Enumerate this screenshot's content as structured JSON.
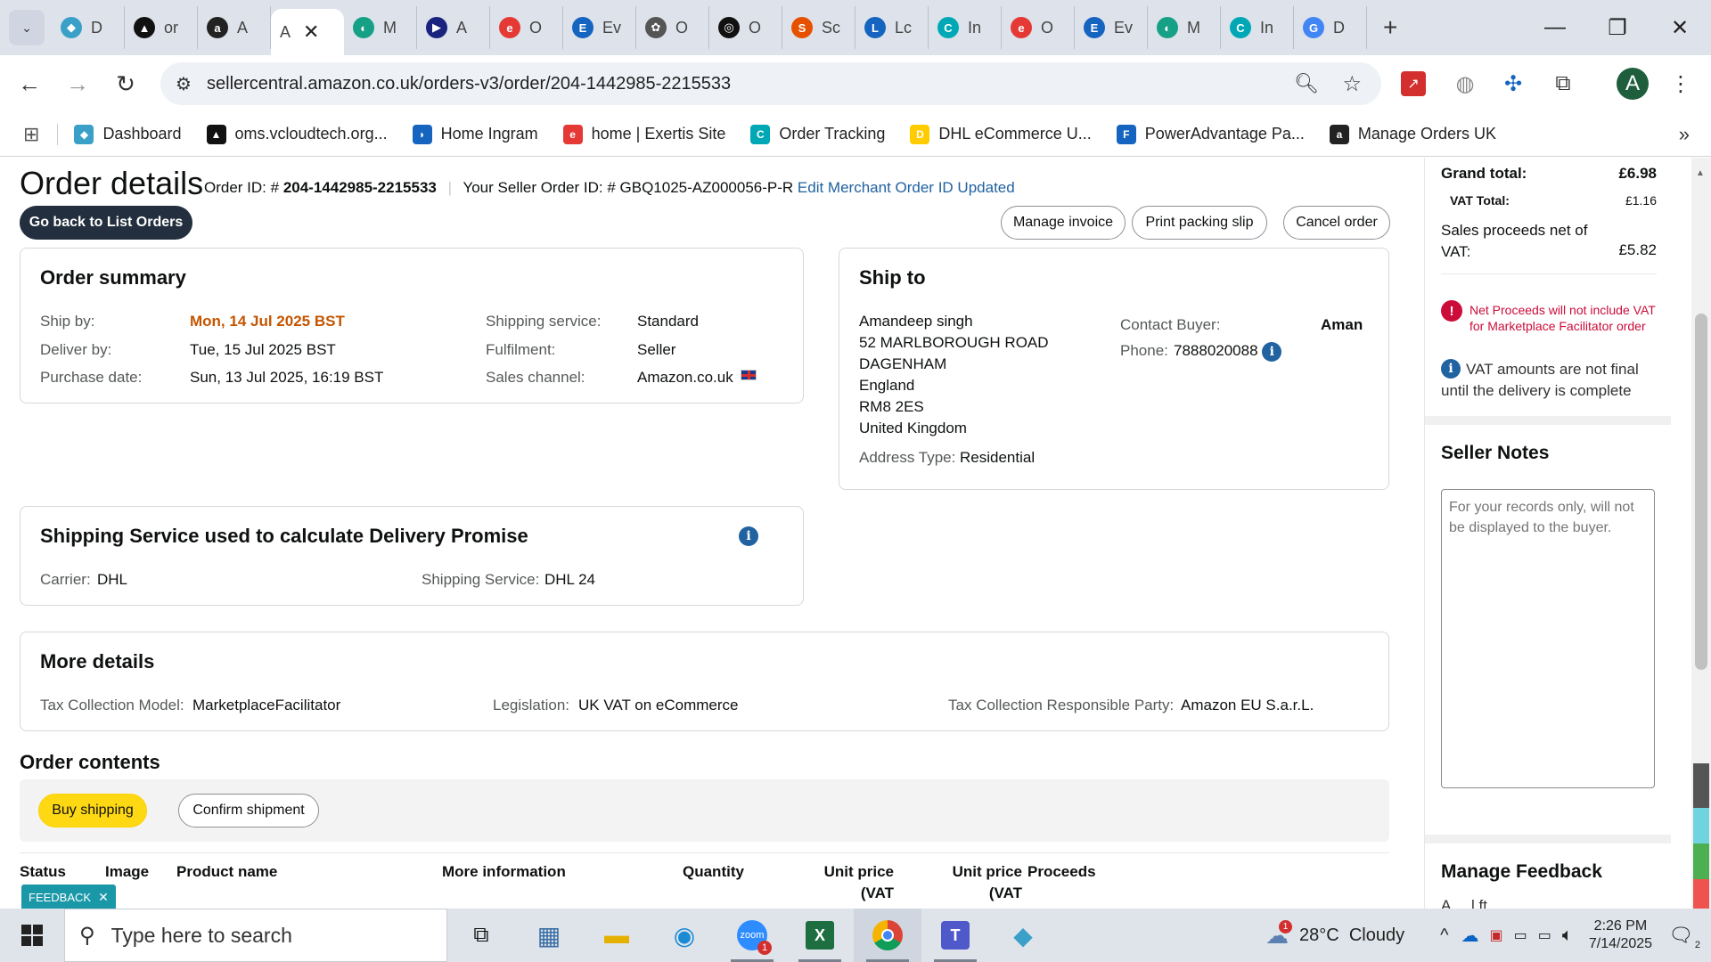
{
  "browser": {
    "tabs": [
      {
        "label": "D",
        "color": "#3aa0c8",
        "glyph": "◆"
      },
      {
        "label": "or",
        "color": "#111111",
        "glyph": "▲"
      },
      {
        "label": "A",
        "color": "#222222",
        "glyph": "a"
      },
      {
        "label": "A",
        "color": "#ffffff",
        "glyph": "",
        "active": true
      },
      {
        "label": "M",
        "color": "#16a085",
        "glyph": "◐"
      },
      {
        "label": "A",
        "color": "#1a237e",
        "glyph": "▶"
      },
      {
        "label": "O",
        "color": "#e53935",
        "glyph": "e"
      },
      {
        "label": "Ev",
        "color": "#1565c0",
        "glyph": "E"
      },
      {
        "label": "O",
        "color": "#555555",
        "glyph": "✿"
      },
      {
        "label": "O",
        "color": "#111111",
        "glyph": "◎"
      },
      {
        "label": "Sc",
        "color": "#e65100",
        "glyph": "S"
      },
      {
        "label": "Lc",
        "color": "#1565c0",
        "glyph": "L"
      },
      {
        "label": "In",
        "color": "#00a8b5",
        "glyph": "C"
      },
      {
        "label": "O",
        "color": "#e53935",
        "glyph": "e"
      },
      {
        "label": "Ev",
        "color": "#1565c0",
        "glyph": "E"
      },
      {
        "label": "M",
        "color": "#16a085",
        "glyph": "◐"
      },
      {
        "label": "In",
        "color": "#00a8b5",
        "glyph": "C"
      },
      {
        "label": "D",
        "color": "#4285f4",
        "glyph": "G"
      }
    ],
    "active_tab_label": "A",
    "url": "sellercentral.amazon.co.uk/orders-v3/order/204-1442985-2215533",
    "profile_initial": "A",
    "bookmarks": [
      {
        "label": "Dashboard",
        "color": "#3aa0c8",
        "glyph": "◆"
      },
      {
        "label": "oms.vcloudtech.org...",
        "color": "#111111",
        "glyph": "▲"
      },
      {
        "label": "Home Ingram",
        "color": "#1565c0",
        "glyph": "◗"
      },
      {
        "label": "home | Exertis Site",
        "color": "#e53935",
        "glyph": "e"
      },
      {
        "label": "Order Tracking",
        "color": "#00a8b5",
        "glyph": "C"
      },
      {
        "label": "DHL eCommerce U...",
        "color": "#ffcc00",
        "glyph": "D"
      },
      {
        "label": "PowerAdvantage Pa...",
        "color": "#1565c0",
        "glyph": "F"
      },
      {
        "label": "Manage Orders UK",
        "color": "#222222",
        "glyph": "a"
      }
    ]
  },
  "header": {
    "title": "Order details",
    "order_id_label": "Order ID: # ",
    "order_id": "204-1442985-2215533",
    "seller_order_label": "Your Seller Order ID: # GBQ1025-AZ000056-P-R",
    "edit_link": "Edit Merchant Order ID",
    "updated_link": "Updated",
    "back_button": "Go back to List Orders",
    "manage_invoice": "Manage invoice",
    "print_slip": "Print packing slip",
    "cancel_order": "Cancel order"
  },
  "order_summary": {
    "title": "Order summary",
    "ship_by_label": "Ship by:",
    "ship_by": "Mon, 14 Jul 2025 BST",
    "deliver_by_label": "Deliver by:",
    "deliver_by": "Tue, 15 Jul 2025 BST",
    "purchase_label": "Purchase date:",
    "purchase": "Sun, 13 Jul 2025, 16:19 BST",
    "service_label": "Shipping service:",
    "service": "Standard",
    "fulfilment_label": "Fulfilment:",
    "fulfilment": "Seller",
    "channel_label": "Sales channel:",
    "channel": "Amazon.co.uk"
  },
  "ship_to": {
    "title": "Ship to",
    "address_lines": [
      "Amandeep singh",
      "52 MARLBOROUGH ROAD",
      "DAGENHAM",
      "England",
      "RM8 2ES",
      "United Kingdom"
    ],
    "address_type_label": "Address Type:",
    "address_type": "Residential",
    "contact_label": "Contact Buyer:",
    "contact_name": "Aman",
    "phone_label": "Phone:",
    "phone": "7888020088"
  },
  "shipping_promise": {
    "title": "Shipping Service used to calculate Delivery Promise",
    "carrier_label": "Carrier:",
    "carrier": "DHL",
    "service_label": "Shipping Service:",
    "service": "DHL 24"
  },
  "more_details": {
    "title": "More details",
    "tax_model_label": "Tax Collection Model:",
    "tax_model": "MarketplaceFacilitator",
    "legislation_label": "Legislation:",
    "legislation": "UK VAT on eCommerce",
    "party_label": "Tax Collection Responsible Party:",
    "party": "Amazon EU S.a.r.L."
  },
  "order_contents": {
    "title": "Order contents",
    "buy_shipping": "Buy shipping",
    "confirm_shipment": "Confirm shipment",
    "columns": [
      "Status",
      "Image",
      "Product name",
      "More information",
      "Quantity",
      "Unit price (VAT",
      "Unit price (VAT",
      "Proceeds"
    ],
    "feedback_tag": "FEEDBACK"
  },
  "sidebar": {
    "grand_total_label": "Grand total:",
    "grand_total": "£6.98",
    "vat_total_label": "VAT Total:",
    "vat_total": "£1.16",
    "net_label": "Sales proceeds net of VAT:",
    "net": "£5.82",
    "warning": "Net Proceeds will not include VAT for Marketplace Facilitator order",
    "info_note": "VAT amounts are not final until the delivery is complete",
    "seller_notes_title": "Seller Notes",
    "seller_notes_placeholder": "For your records only, will not be displayed to the buyer.",
    "feedback_title": "Manage Feedback",
    "feedback_partial": "A  ...  l  ft"
  },
  "taskbar": {
    "search_placeholder": "Type here to search",
    "zoom_badge": "1",
    "weather": "28°C  Cloudy",
    "weather_badge": "1",
    "time": "2:26 PM",
    "date": "7/14/2025",
    "notif_count": "2"
  }
}
